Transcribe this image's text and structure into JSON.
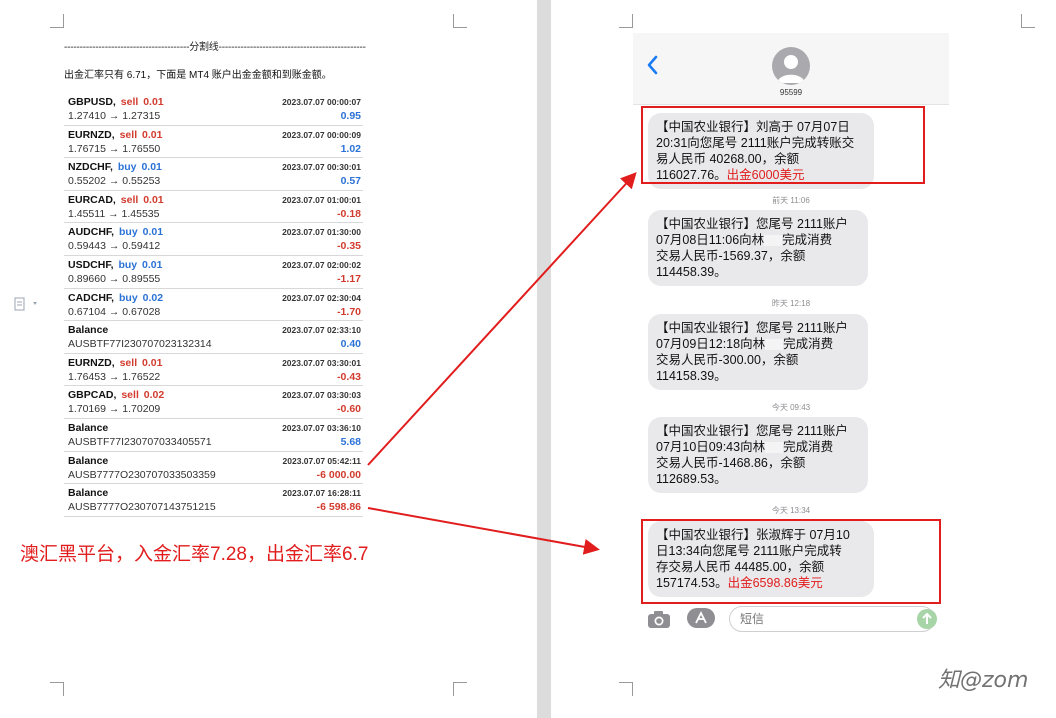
{
  "document": {
    "divider_text": "----------------------------------------分割线-----------------------------------------------",
    "intro_text": "出金汇率只有 6.71，下面是 MT4 账户出金金额和到账金额。",
    "trades": [
      {
        "symbol": "GBPUSD,",
        "action": "sell",
        "lot": "0.01",
        "time": "2023.07.07 00:00:07",
        "detail": "1.27410 → 1.27315",
        "profit": "0.95",
        "sign": "pos"
      },
      {
        "symbol": "EURNZD,",
        "action": "sell",
        "lot": "0.01",
        "time": "2023.07.07 00:00:09",
        "detail": "1.76715 → 1.76550",
        "profit": "1.02",
        "sign": "pos"
      },
      {
        "symbol": "NZDCHF,",
        "action": "buy",
        "lot": "0.01",
        "time": "2023.07.07 00:30:01",
        "detail": "0.55202 → 0.55253",
        "profit": "0.57",
        "sign": "pos"
      },
      {
        "symbol": "EURCAD,",
        "action": "sell",
        "lot": "0.01",
        "time": "2023.07.07 01:00:01",
        "detail": "1.45511 → 1.45535",
        "profit": "-0.18",
        "sign": "neg"
      },
      {
        "symbol": "AUDCHF,",
        "action": "buy",
        "lot": "0.01",
        "time": "2023.07.07 01:30:00",
        "detail": "0.59443 → 0.59412",
        "profit": "-0.35",
        "sign": "neg"
      },
      {
        "symbol": "USDCHF,",
        "action": "buy",
        "lot": "0.01",
        "time": "2023.07.07 02:00:02",
        "detail": "0.89660 → 0.89555",
        "profit": "-1.17",
        "sign": "neg"
      },
      {
        "symbol": "CADCHF,",
        "action": "buy",
        "lot": "0.02",
        "time": "2023.07.07 02:30:04",
        "detail": "0.67104 → 0.67028",
        "profit": "-1.70",
        "sign": "neg"
      },
      {
        "symbol": "Balance",
        "action": "",
        "lot": "",
        "time": "2023.07.07 02:33:10",
        "detail": "AUSBTF77I230707023132314",
        "profit": "0.40",
        "sign": "pos"
      },
      {
        "symbol": "EURNZD,",
        "action": "sell",
        "lot": "0.01",
        "time": "2023.07.07 03:30:01",
        "detail": "1.76453 → 1.76522",
        "profit": "-0.43",
        "sign": "neg"
      },
      {
        "symbol": "GBPCAD,",
        "action": "sell",
        "lot": "0.02",
        "time": "2023.07.07 03:30:03",
        "detail": "1.70169 → 1.70209",
        "profit": "-0.60",
        "sign": "neg"
      },
      {
        "symbol": "Balance",
        "action": "",
        "lot": "",
        "time": "2023.07.07 03:36:10",
        "detail": "AUSBTF77I230707033405571",
        "profit": "5.68",
        "sign": "pos"
      },
      {
        "symbol": "Balance",
        "action": "",
        "lot": "",
        "time": "2023.07.07 05:42:11",
        "detail": "AUSB7777O230707033503359",
        "profit": "-6 000.00",
        "sign": "neg"
      },
      {
        "symbol": "Balance",
        "action": "",
        "lot": "",
        "time": "2023.07.07 16:28:11",
        "detail": "AUSB7777O230707143751215",
        "profit": "-6 598.86",
        "sign": "neg"
      }
    ],
    "caption": "澳汇黑平台，入金汇率7.28，出金汇率6.7"
  },
  "phone": {
    "contact_number": "95599",
    "back_icon": "chevron-left-icon",
    "input_placeholder": "短信",
    "messages": [
      {
        "timestamp": "",
        "lines": [
          "【中国农业银行】刘高于 07月07日",
          "20:31向您尾号 2111账户完成转账交",
          "易人民币 40268.00，余额",
          "116027.76。"
        ],
        "amount_note": "出金6000美元",
        "highlighted": true
      },
      {
        "timestamp": "前天 11:06",
        "lines": [
          "【中国农业银行】您尾号 2111账户",
          "07月08日11:06向林",
          "完成消费",
          "交易人民币-1569.37，余额",
          "114458.39。"
        ],
        "amount_note": "",
        "highlighted": false
      },
      {
        "timestamp": "昨天 12:18",
        "lines": [
          "【中国农业银行】您尾号 2111账户",
          "07月09日12:18向林",
          "完成消费",
          "交易人民币-300.00，余额",
          "114158.39。"
        ],
        "amount_note": "",
        "highlighted": false
      },
      {
        "timestamp": "今天 09:43",
        "lines": [
          "【中国农业银行】您尾号 2111账户",
          "07月10日09:43向林",
          "完成消费",
          "交易人民币-1468.86，余额",
          "112689.53。"
        ],
        "amount_note": "",
        "highlighted": false
      },
      {
        "timestamp": "今天 13:34",
        "lines": [
          "【中国农业银行】张淑辉于 07月10",
          "日13:34向您尾号 2111账户完成转",
          "存交易人民币 44485.00，余额",
          "157174.53。"
        ],
        "amount_note": "出金6598.86美元",
        "highlighted": true
      }
    ]
  },
  "watermark": "知@zom",
  "colors": {
    "annotation_red": "#e11d1d",
    "sell_red": "#d23b2e",
    "buy_blue": "#2b72d6",
    "ios_blue": "#1a7cf5",
    "bubble_gray": "#e9e9eb"
  }
}
